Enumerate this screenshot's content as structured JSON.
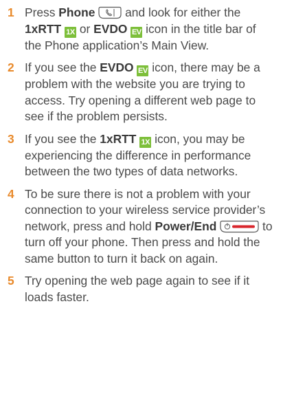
{
  "steps": [
    {
      "number": "1",
      "parts": {
        "a": "Press ",
        "b": "Phone",
        "c": " and look for either the ",
        "d": "1xRTT",
        "e": " or ",
        "f": "EVDO",
        "g": " icon in the title bar of the Phone application’s Main View."
      }
    },
    {
      "number": "2",
      "parts": {
        "a": "If you see the ",
        "b": "EVDO",
        "c": " icon, there may be a problem with the website you are trying to access. Try opening a different web page to see if the problem persists."
      }
    },
    {
      "number": "3",
      "parts": {
        "a": "If you see the ",
        "b": "1xRTT",
        "c": " icon, you may be experiencing the difference in performance between the two types of data networks."
      }
    },
    {
      "number": "4",
      "parts": {
        "a": "To be sure there is not a problem with your connection to your wireless service provider’s network, press and hold ",
        "b": "Power/End",
        "c": " to turn off your phone. Then press and hold the same button to turn it back on again."
      }
    },
    {
      "number": "5",
      "parts": {
        "a": "Try opening the web page again to see if it loads faster."
      }
    }
  ],
  "icons": {
    "onex_badge": "1X",
    "evdo_badge": "EV",
    "phone_key": "phone-key-icon",
    "power_key": "power-end-key-icon"
  },
  "colors": {
    "step_number": "#e8892a",
    "body_text": "#4a4a4a",
    "badge_green": "#7dbf3a",
    "power_red": "#d9262c"
  }
}
